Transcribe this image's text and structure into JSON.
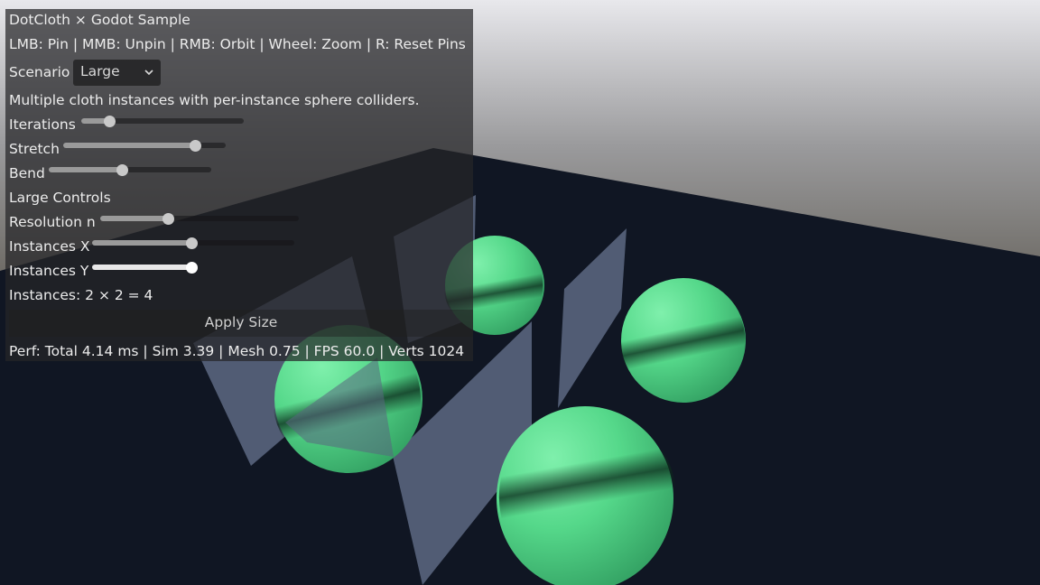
{
  "window": {
    "title": "DotCloth × Godot Sample"
  },
  "help_text": "LMB: Pin | MMB: Unpin | RMB: Orbit | Wheel: Zoom | R: Reset Pins",
  "scenario": {
    "label": "Scenario",
    "selected": "Large"
  },
  "description": "Multiple cloth instances with per-instance sphere colliders.",
  "sliders": {
    "iterations": {
      "label": "Iterations",
      "level": 0.17
    },
    "stretch": {
      "label": "Stretch",
      "level": 0.81
    },
    "bend": {
      "label": "Bend",
      "level": 0.45
    }
  },
  "large_controls": {
    "heading": "Large Controls",
    "resolution": {
      "label": "Resolution n",
      "level": 0.34
    },
    "instances_x": {
      "label": "Instances X",
      "level": 0.49
    },
    "instances_y": {
      "label": "Instances Y",
      "level": 1.0
    },
    "instances_summary": "Instances: 2 × 2 = 4",
    "apply_label": "Apply Size"
  },
  "perf": "Perf: Total 4.14 ms | Sim 3.39 | Mesh 0.75 | FPS 60.0 | Verts 1024",
  "colors": {
    "cloth": "#5a6680",
    "sphere": "#5fe092",
    "floor": "#101623",
    "panel": "#262628"
  }
}
